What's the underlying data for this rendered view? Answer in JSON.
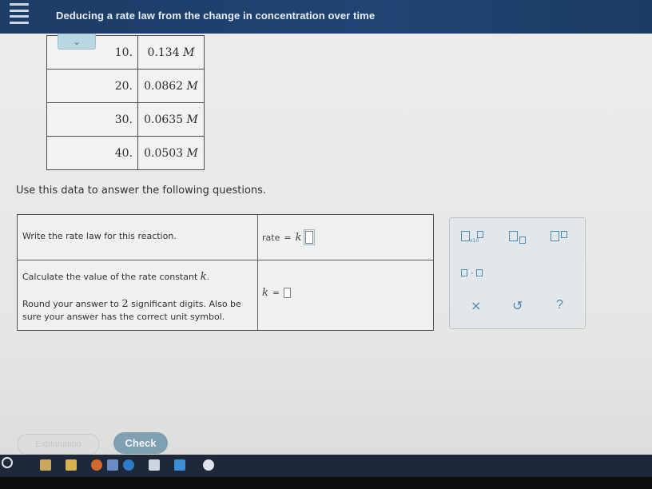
{
  "header": {
    "title": "Deducing a rate law from the change in concentration over time"
  },
  "data_table": {
    "rows": [
      {
        "time": "10.",
        "conc": "0.134",
        "unit": "M"
      },
      {
        "time": "20.",
        "conc": "0.0862",
        "unit": "M"
      },
      {
        "time": "30.",
        "conc": "0.0635",
        "unit": "M"
      },
      {
        "time": "40.",
        "conc": "0.0503",
        "unit": "M"
      }
    ]
  },
  "instructions": "Use this data to answer the following questions.",
  "questions": {
    "q1": {
      "prompt": "Write the rate law for this reaction.",
      "answer_prefix": "rate",
      "answer_eq": "=",
      "answer_var": "k"
    },
    "q2": {
      "prompt": "Calculate the value of the rate constant",
      "prompt_var": "k",
      "prompt_end": ".",
      "round_prefix": "Round your answer to",
      "round_num": "2",
      "round_suffix": "significant digits. Also be sure your answer has the correct unit symbol.",
      "answer_var": "k",
      "answer_eq": "="
    }
  },
  "palette": {
    "x10_label": "x10",
    "cross": "×",
    "undo": "↺",
    "help": "?"
  },
  "buttons": {
    "explanation": "Explanation",
    "check": "Check"
  },
  "colors": {
    "header_bg": "#1e3c66",
    "accent": "#4e88b5",
    "check_bg": "#7f9fb2"
  }
}
